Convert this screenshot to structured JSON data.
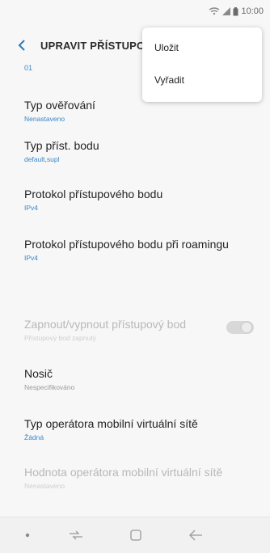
{
  "status": {
    "time": "10:00"
  },
  "header": {
    "title": "UPRAVIT PŘÍSTUPO"
  },
  "partial_value_top": "01",
  "items": [
    {
      "label": "Typ ověřování",
      "value": "Nenastaveno"
    },
    {
      "label": "Typ příst. bodu",
      "value": "default,supl"
    },
    {
      "label": "Protokol přístupového bodu",
      "value": "IPv4"
    },
    {
      "label": "Protokol přístupového bodu při roamingu",
      "value": "IPv4"
    },
    {
      "label": "Zapnout/vypnout přístupový bod",
      "value": "Přístupový bod zapnutý"
    },
    {
      "label": "Nosič",
      "value": "Nespecifikováno"
    },
    {
      "label": "Typ operátora mobilní virtuální sítě",
      "value": "Žádná"
    },
    {
      "label": "Hodnota operátora mobilní virtuální sítě",
      "value": "Nenastaveno"
    }
  ],
  "menu": {
    "items": [
      {
        "label": "Uložit"
      },
      {
        "label": "Vyřadit"
      }
    ]
  },
  "toggle": {
    "state": "on",
    "enabled": false
  },
  "colors": {
    "accent": "#2b7bb9",
    "value_text": "#3a86c8"
  }
}
